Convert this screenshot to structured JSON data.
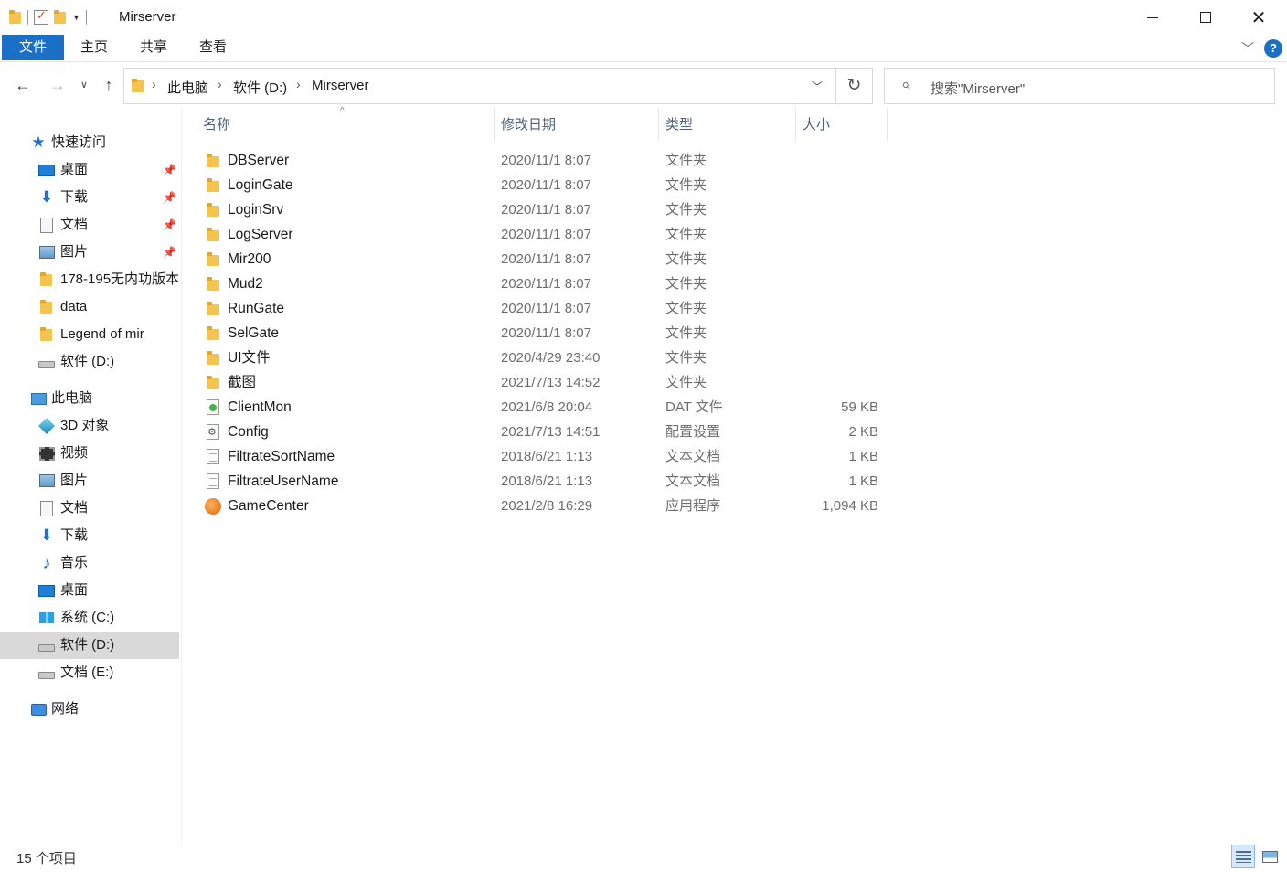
{
  "window": {
    "title": "Mirserver",
    "minimize_glyph": "—",
    "close_glyph": "✕"
  },
  "ribbon": {
    "tabs": [
      "文件",
      "主页",
      "共享",
      "查看"
    ],
    "help_glyph": "?",
    "collapse_glyph": "﹀"
  },
  "nav": {
    "back_glyph": "←",
    "forward_glyph": "→",
    "recent_glyph": "∨",
    "up_glyph": "↑",
    "breadcrumbs": [
      "此电脑",
      "软件 (D:)",
      "Mirserver"
    ],
    "crumb_separator": "›",
    "refresh_glyph": "↻",
    "search_placeholder": "搜索\"Mirserver\""
  },
  "sidebar": {
    "quick_access": "快速访问",
    "pinned": [
      {
        "label": "桌面",
        "icon": "desktop-icon"
      },
      {
        "label": "下载",
        "icon": "download-icon"
      },
      {
        "label": "文档",
        "icon": "documents-icon"
      },
      {
        "label": "图片",
        "icon": "pictures-icon"
      }
    ],
    "recent": [
      {
        "label": "178-195无内功版本",
        "icon": "folder-icon"
      },
      {
        "label": "data",
        "icon": "folder-icon"
      },
      {
        "label": "Legend of mir",
        "icon": "folder-icon"
      },
      {
        "label": "软件 (D:)",
        "icon": "drive-icon"
      }
    ],
    "this_pc": "此电脑",
    "pc_items": [
      {
        "label": "3D 对象",
        "icon": "3d-objects-icon"
      },
      {
        "label": "视频",
        "icon": "videos-icon"
      },
      {
        "label": "图片",
        "icon": "pictures-icon"
      },
      {
        "label": "文档",
        "icon": "documents-icon"
      },
      {
        "label": "下载",
        "icon": "download-icon"
      },
      {
        "label": "音乐",
        "icon": "music-icon"
      },
      {
        "label": "桌面",
        "icon": "desktop-icon"
      },
      {
        "label": "系统 (C:)",
        "icon": "system-drive-icon"
      },
      {
        "label": "软件 (D:)",
        "icon": "drive-icon",
        "selected": true
      },
      {
        "label": "文档 (E:)",
        "icon": "drive-icon"
      }
    ],
    "network": "网络"
  },
  "columns": {
    "name": "名称",
    "date": "修改日期",
    "type": "类型",
    "size": "大小",
    "sort_glyph": "^"
  },
  "files": [
    {
      "name": "DBServer",
      "date": "2020/11/1 8:07",
      "type": "文件夹",
      "size": "",
      "icon": "folder-icon"
    },
    {
      "name": "LoginGate",
      "date": "2020/11/1 8:07",
      "type": "文件夹",
      "size": "",
      "icon": "folder-icon"
    },
    {
      "name": "LoginSrv",
      "date": "2020/11/1 8:07",
      "type": "文件夹",
      "size": "",
      "icon": "folder-icon"
    },
    {
      "name": "LogServer",
      "date": "2020/11/1 8:07",
      "type": "文件夹",
      "size": "",
      "icon": "folder-icon"
    },
    {
      "name": "Mir200",
      "date": "2020/11/1 8:07",
      "type": "文件夹",
      "size": "",
      "icon": "folder-icon"
    },
    {
      "name": "Mud2",
      "date": "2020/11/1 8:07",
      "type": "文件夹",
      "size": "",
      "icon": "folder-icon"
    },
    {
      "name": "RunGate",
      "date": "2020/11/1 8:07",
      "type": "文件夹",
      "size": "",
      "icon": "folder-icon"
    },
    {
      "name": "SelGate",
      "date": "2020/11/1 8:07",
      "type": "文件夹",
      "size": "",
      "icon": "folder-icon"
    },
    {
      "name": "UI文件",
      "date": "2020/4/29 23:40",
      "type": "文件夹",
      "size": "",
      "icon": "folder-icon"
    },
    {
      "name": "截图",
      "date": "2021/7/13 14:52",
      "type": "文件夹",
      "size": "",
      "icon": "folder-icon"
    },
    {
      "name": "ClientMon",
      "date": "2021/6/8 20:04",
      "type": "DAT 文件",
      "size": "59 KB",
      "icon": "dat-file-icon"
    },
    {
      "name": "Config",
      "date": "2021/7/13 14:51",
      "type": "配置设置",
      "size": "2 KB",
      "icon": "config-file-icon"
    },
    {
      "name": "FiltrateSortName",
      "date": "2018/6/21 1:13",
      "type": "文本文档",
      "size": "1 KB",
      "icon": "text-file-icon"
    },
    {
      "name": "FiltrateUserName",
      "date": "2018/6/21 1:13",
      "type": "文本文档",
      "size": "1 KB",
      "icon": "text-file-icon"
    },
    {
      "name": "GameCenter",
      "date": "2021/2/8 16:29",
      "type": "应用程序",
      "size": "1,094 KB",
      "icon": "application-icon"
    }
  ],
  "status": {
    "item_count": "15 个项目"
  },
  "colors": {
    "accent": "#1a6fc7",
    "selection": "#d9d9d9",
    "header_text": "#4c607a",
    "folder": "#f3c44f"
  }
}
